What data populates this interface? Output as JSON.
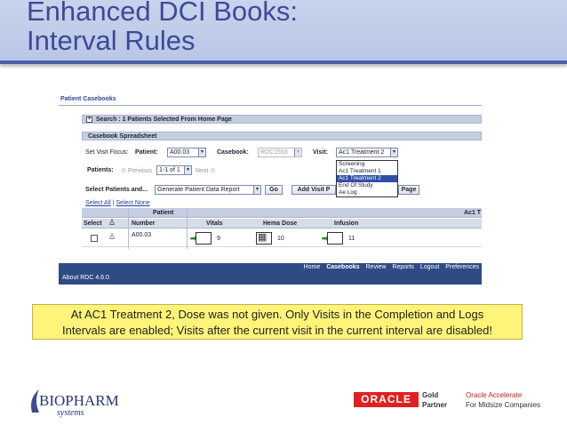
{
  "slide": {
    "title_line1": "Enhanced DCI Books:",
    "title_line2": "Interval Rules",
    "callout_line1": "At AC1 Treatment 2, Dose was not given.  Only Visits in the Completion and Logs",
    "callout_line2": "Intervals are enabled; Visits after the current visit in the current interval are disabled!"
  },
  "app": {
    "page_title": "Patient Casebooks",
    "search_bar": "Search : 1 Patients Selected From Home Page",
    "spreadsheet_header": "Casebook Spreadsheet",
    "set_visit_focus_label": "Set Visit Focus:",
    "patient_label": "Patient:",
    "patient_value": "A00.03",
    "casebook_label": "Casebook:",
    "casebook_value": "RDC1553",
    "visit_label": "Visit:",
    "visit_value": "Ac1 Treatment 2",
    "visit_options": [
      "Screening",
      "Ac1 Treatment 1",
      "Ac1 Treatment 2",
      "End Of Study",
      "Ae Log"
    ],
    "visit_selected_index": 2,
    "patients_label": "Patients:",
    "previous_label": "Previous",
    "page_value": "1-1 of 1",
    "next_label": "Next",
    "select_patients_label": "Select Patients and...",
    "report_value": "Generate Patient Data Report",
    "go_button": "Go",
    "add_visit_button": "Add Visit P",
    "page_button": "Page",
    "select_all": "Select All",
    "select_none": "Select None",
    "grid": {
      "group_patient": "Patient",
      "group_visit": "Ac1 T",
      "col_select": "Select",
      "col_number": "Number",
      "col_vitals": "Vitals",
      "col_hema_dose": "Hema Dose",
      "col_infusion": "Infusion",
      "row": {
        "number": "A00.03",
        "vitals": "9",
        "hema_dose": "10",
        "infusion": "11"
      }
    },
    "footer_nav": [
      "Home",
      "Casebooks",
      "Review",
      "Reports",
      "Logout",
      "Preferences"
    ],
    "footer_active": "Casebooks",
    "footer_about": "About RDC 4.6.0"
  },
  "logos": {
    "biopharm_text": "BIOPHARM",
    "biopharm_sub": "systems",
    "oracle": "ORACLE",
    "gold": "Gold",
    "partner": "Partner",
    "oracle_accelerate": "Oracle Accelerate",
    "midsize": "For Midsize Companies"
  },
  "colors": {
    "title": "#3c4a98",
    "title_band": "#c0cce9",
    "footer_bar": "#2f4b84",
    "callout": "#fff47a",
    "oracle_red": "#e02020",
    "highlight": "#2f4fa8"
  }
}
